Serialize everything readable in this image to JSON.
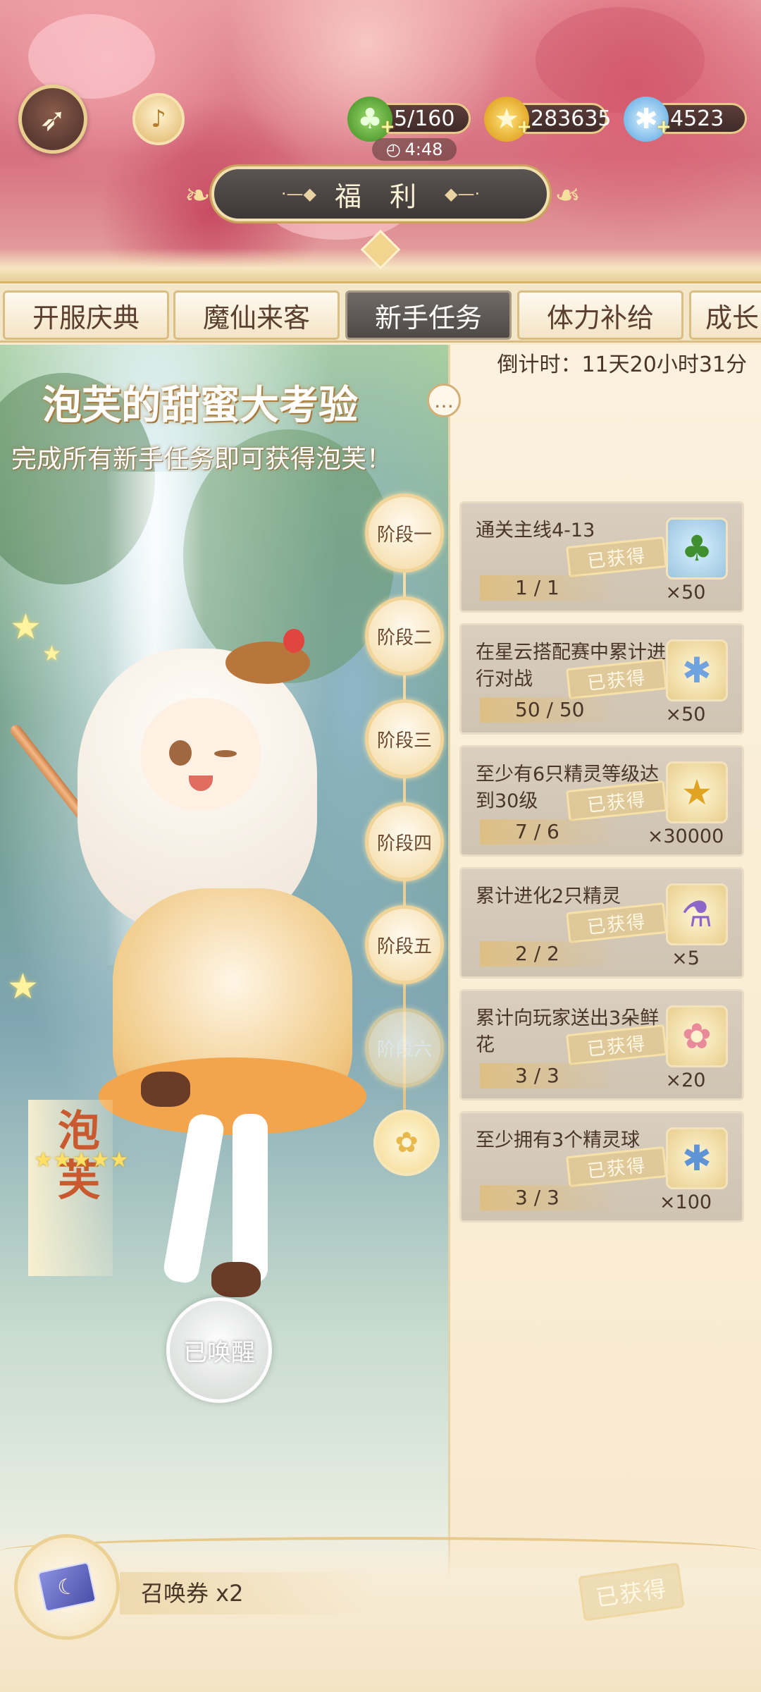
{
  "header": {
    "title": "福 利",
    "resources": {
      "stamina": "5/160",
      "stamina_timer": "4:48",
      "gold": "283635",
      "crystal": "4523"
    },
    "icons": {
      "back": "back-arrow-icon",
      "bell": "bell-icon",
      "clover": "clover-icon",
      "coin": "coin-icon",
      "crystal": "crystal-icon",
      "clock": "clock-icon"
    },
    "glyphs": {
      "clock": "◴",
      "plus": "+"
    }
  },
  "tabs": [
    {
      "label": "开服庆典"
    },
    {
      "label": "魔仙来客"
    },
    {
      "label": "新手任务",
      "active": true
    },
    {
      "label": "体力补给"
    },
    {
      "label": "成长"
    }
  ],
  "event": {
    "countdown": "倒计时：11天20小时31分",
    "title": "泡芙的甜蜜大考验",
    "subtitle": "完成所有新手任务即可获得泡芙！",
    "character_name": "泡芙",
    "rarity_stars": 5,
    "awaken_label": "已唤醒"
  },
  "stages": [
    {
      "label": "阶段一"
    },
    {
      "label": "阶段二"
    },
    {
      "label": "阶段三"
    },
    {
      "label": "阶段四"
    },
    {
      "label": "阶段五"
    },
    {
      "label": "阶段六"
    }
  ],
  "tasks": [
    {
      "text": "通关主线4-13",
      "progress": "1 / 1",
      "status": "已获得",
      "reward_icon": "clover-icon",
      "reward_count": "×50"
    },
    {
      "text": "在星云搭配赛中累计进行对战",
      "progress": "50 / 50",
      "status": "已获得",
      "reward_icon": "crystal-icon",
      "reward_count": "×50"
    },
    {
      "text": "至少有6只精灵等级达到30级",
      "progress": "7 / 6",
      "status": "已获得",
      "reward_icon": "coin-icon",
      "reward_count": "×30000"
    },
    {
      "text": "累计进化2只精灵",
      "progress": "2 / 2",
      "status": "已获得",
      "reward_icon": "potion-icon",
      "reward_count": "×5"
    },
    {
      "text": "累计向玩家送出3朵鲜花",
      "progress": "3 / 3",
      "status": "已获得",
      "reward_icon": "flower-icon",
      "reward_count": "×20"
    },
    {
      "text": "至少拥有3个精灵球",
      "progress": "3 / 3",
      "status": "已获得",
      "reward_icon": "crystal-ball-icon",
      "reward_count": "×100"
    }
  ],
  "bottom": {
    "reward_label": "召唤券 x2",
    "reward_icon": "summon-ticket-icon",
    "status": "已获得"
  },
  "colors": {
    "tab_active": "#5a5452",
    "task_card": "#d3c7b6",
    "accent_gold": "#e8c98a"
  }
}
